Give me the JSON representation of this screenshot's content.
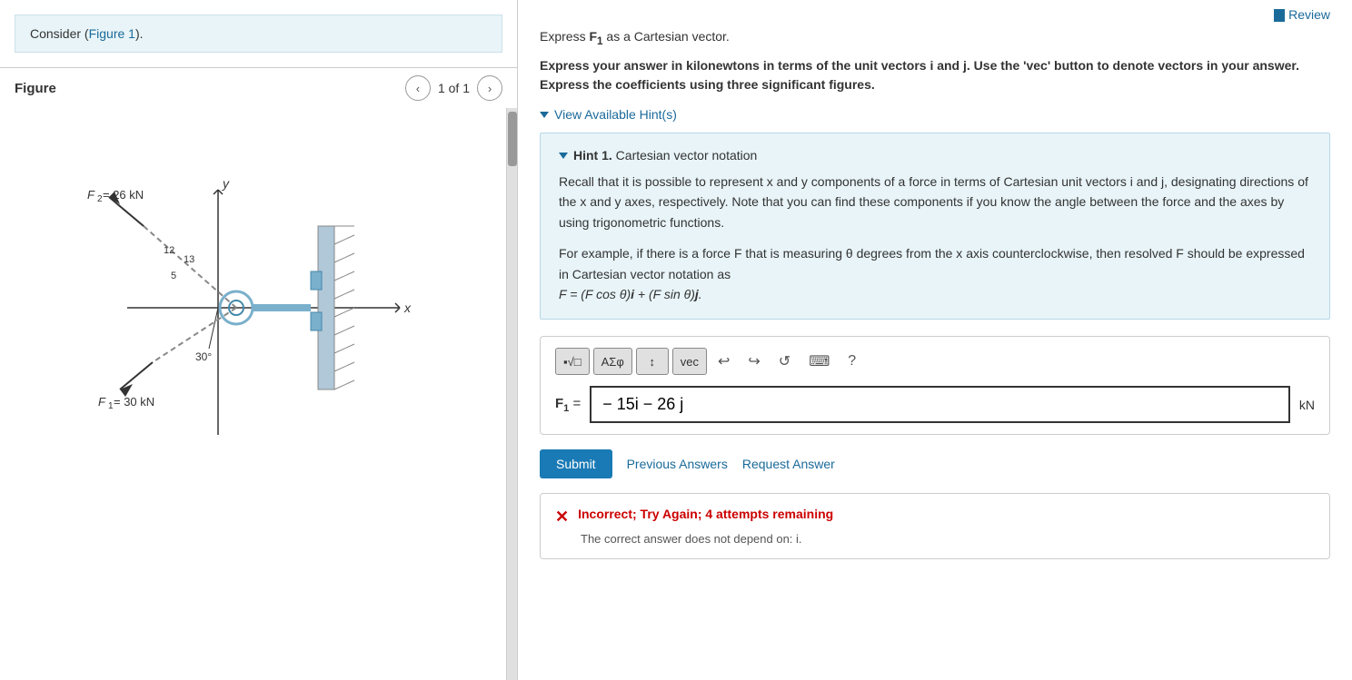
{
  "left": {
    "consider_text": "Consider (",
    "figure_link": "Figure 1",
    "consider_end": ").",
    "figure_label": "Figure",
    "page_indicator": "1 of 1",
    "nav_prev": "‹",
    "nav_next": "›"
  },
  "right": {
    "review_label": "Review",
    "express_f1": "Express F",
    "express_f1_sub": "1",
    "express_f1_rest": " as a Cartesian vector.",
    "instructions": "Express your answer in kilonewtons in terms of the unit vectors i and j. Use the 'vec' button to denote vectors in your answer. Express the coefficients using three significant figures.",
    "view_hint": "View Available Hint(s)",
    "hint_title": "Hint 1.",
    "hint_title_rest": " Cartesian vector notation",
    "hint_text1": "Recall that it is possible to represent x and y components of a force in terms of Cartesian unit vectors i and j, designating directions of the x and y axes, respectively. Note that you can find these components if you know the angle between the force and the axes by using trigonometric functions.",
    "hint_text2": "For example, if there is a force F that is measuring θ degrees from the x axis counterclockwise, then resolved F should be expressed in Cartesian vector notation as",
    "hint_formula": "F = (F cos θ)i + (F sin θ)j.",
    "toolbar": {
      "btn1": "▪√□",
      "btn2": "ΑΣφ",
      "btn3": "↕",
      "btn4": "vec",
      "undo_icon": "↩",
      "redo_icon": "↪",
      "refresh_icon": "↺",
      "keyboard_icon": "⌨",
      "help_icon": "?"
    },
    "f1_label": "F",
    "f1_sub": "1",
    "f1_equals": "=",
    "answer_value": "− 15i − 26 j",
    "unit": "kN",
    "submit_label": "Submit",
    "prev_answers_label": "Previous Answers",
    "request_answer_label": "Request Answer",
    "result_icon": "✕",
    "result_title": "Incorrect; Try Again; 4 attempts remaining",
    "result_detail": "The correct answer does not depend on: i."
  }
}
